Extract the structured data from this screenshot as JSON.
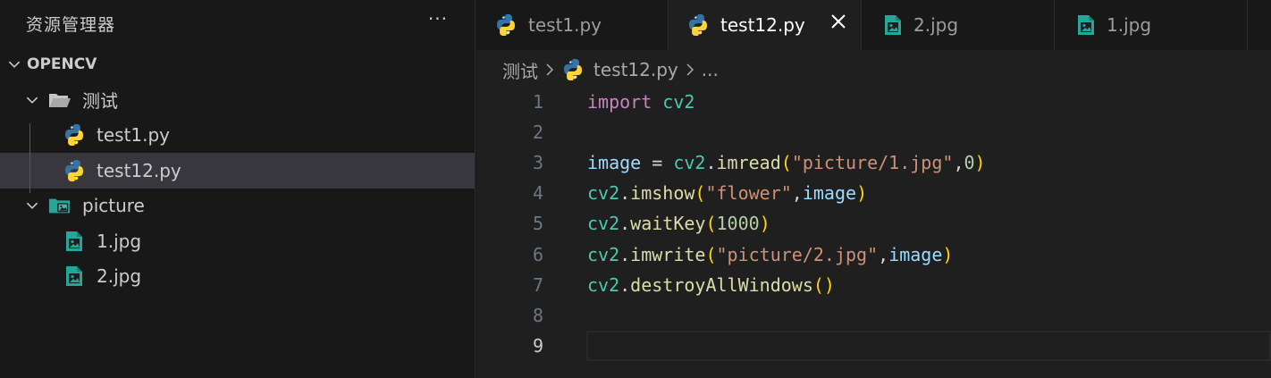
{
  "explorer": {
    "title": "资源管理器",
    "more_label": "···",
    "section_label": "OPENCV",
    "items": [
      {
        "label": "测试",
        "type": "folder"
      },
      {
        "label": "test1.py",
        "type": "python"
      },
      {
        "label": "test12.py",
        "type": "python",
        "selected": true
      },
      {
        "label": "picture",
        "type": "image-folder"
      },
      {
        "label": "1.jpg",
        "type": "image"
      },
      {
        "label": "2.jpg",
        "type": "image"
      }
    ]
  },
  "tabs": [
    {
      "label": "test1.py",
      "icon": "python-icon",
      "active": false
    },
    {
      "label": "test12.py",
      "icon": "python-icon",
      "active": true
    },
    {
      "label": "2.jpg",
      "icon": "image-icon",
      "active": false
    },
    {
      "label": "1.jpg",
      "icon": "image-icon",
      "active": false
    }
  ],
  "breadcrumb": {
    "folder": "测试",
    "file": "test12.py",
    "ellipsis": "..."
  },
  "editor": {
    "line_numbers": [
      "1",
      "2",
      "3",
      "4",
      "5",
      "6",
      "7",
      "8",
      "9"
    ],
    "current_line": "9",
    "lines": [
      [
        [
          "kw",
          "import"
        ],
        [
          "op",
          " "
        ],
        [
          "mod",
          "cv2"
        ]
      ],
      [],
      [
        [
          "var",
          "image"
        ],
        [
          "op",
          " = "
        ],
        [
          "mod",
          "cv2"
        ],
        [
          "op",
          "."
        ],
        [
          "fn",
          "imread"
        ],
        [
          "p1",
          "("
        ],
        [
          "str",
          "\"picture/1.jpg\""
        ],
        [
          "pun",
          ","
        ],
        [
          "num",
          "0"
        ],
        [
          "p1",
          ")"
        ]
      ],
      [
        [
          "mod",
          "cv2"
        ],
        [
          "op",
          "."
        ],
        [
          "fn",
          "imshow"
        ],
        [
          "p1",
          "("
        ],
        [
          "str",
          "\"flower\""
        ],
        [
          "pun",
          ","
        ],
        [
          "var",
          "image"
        ],
        [
          "p1",
          ")"
        ]
      ],
      [
        [
          "mod",
          "cv2"
        ],
        [
          "op",
          "."
        ],
        [
          "fn",
          "waitKey"
        ],
        [
          "p1",
          "("
        ],
        [
          "num",
          "1000"
        ],
        [
          "p1",
          ")"
        ]
      ],
      [
        [
          "mod",
          "cv2"
        ],
        [
          "op",
          "."
        ],
        [
          "fn",
          "imwrite"
        ],
        [
          "p1",
          "("
        ],
        [
          "str",
          "\"picture/2.jpg\""
        ],
        [
          "pun",
          ","
        ],
        [
          "var",
          "image"
        ],
        [
          "p1",
          ")"
        ]
      ],
      [
        [
          "mod",
          "cv2"
        ],
        [
          "op",
          "."
        ],
        [
          "fn",
          "destroyAllWindows"
        ],
        [
          "p1",
          "()"
        ]
      ],
      [],
      []
    ]
  },
  "colors": {
    "python_blue": "#3572A5",
    "python_yellow": "#FFD43B",
    "image_teal": "#26a69a",
    "folder_gray": "#c5c5c5"
  }
}
